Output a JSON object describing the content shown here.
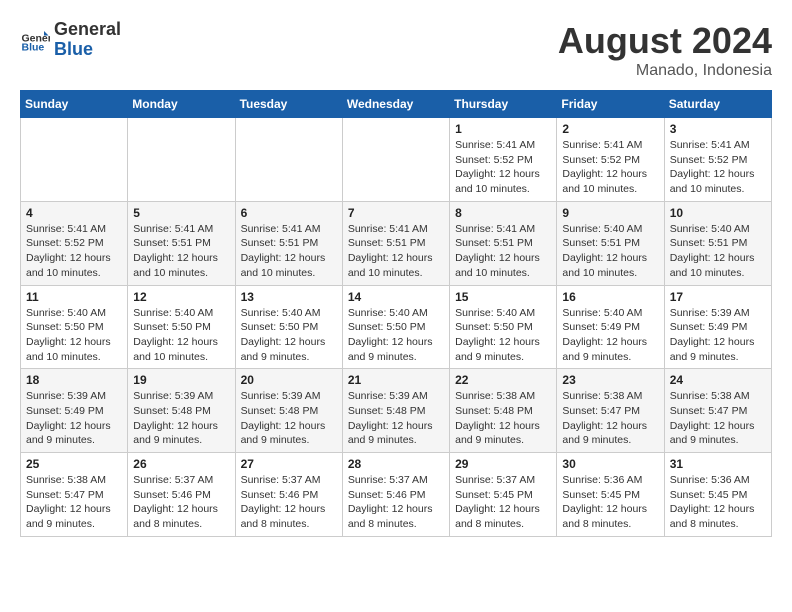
{
  "header": {
    "logo_text_general": "General",
    "logo_text_blue": "Blue",
    "month_year": "August 2024",
    "location": "Manado, Indonesia"
  },
  "days_of_week": [
    "Sunday",
    "Monday",
    "Tuesday",
    "Wednesday",
    "Thursday",
    "Friday",
    "Saturday"
  ],
  "weeks": [
    {
      "row_style": "white",
      "days": [
        {
          "num": "",
          "info": ""
        },
        {
          "num": "",
          "info": ""
        },
        {
          "num": "",
          "info": ""
        },
        {
          "num": "",
          "info": ""
        },
        {
          "num": "1",
          "info": "Sunrise: 5:41 AM\nSunset: 5:52 PM\nDaylight: 12 hours\nand 10 minutes."
        },
        {
          "num": "2",
          "info": "Sunrise: 5:41 AM\nSunset: 5:52 PM\nDaylight: 12 hours\nand 10 minutes."
        },
        {
          "num": "3",
          "info": "Sunrise: 5:41 AM\nSunset: 5:52 PM\nDaylight: 12 hours\nand 10 minutes."
        }
      ]
    },
    {
      "row_style": "gray",
      "days": [
        {
          "num": "4",
          "info": "Sunrise: 5:41 AM\nSunset: 5:52 PM\nDaylight: 12 hours\nand 10 minutes."
        },
        {
          "num": "5",
          "info": "Sunrise: 5:41 AM\nSunset: 5:51 PM\nDaylight: 12 hours\nand 10 minutes."
        },
        {
          "num": "6",
          "info": "Sunrise: 5:41 AM\nSunset: 5:51 PM\nDaylight: 12 hours\nand 10 minutes."
        },
        {
          "num": "7",
          "info": "Sunrise: 5:41 AM\nSunset: 5:51 PM\nDaylight: 12 hours\nand 10 minutes."
        },
        {
          "num": "8",
          "info": "Sunrise: 5:41 AM\nSunset: 5:51 PM\nDaylight: 12 hours\nand 10 minutes."
        },
        {
          "num": "9",
          "info": "Sunrise: 5:40 AM\nSunset: 5:51 PM\nDaylight: 12 hours\nand 10 minutes."
        },
        {
          "num": "10",
          "info": "Sunrise: 5:40 AM\nSunset: 5:51 PM\nDaylight: 12 hours\nand 10 minutes."
        }
      ]
    },
    {
      "row_style": "white",
      "days": [
        {
          "num": "11",
          "info": "Sunrise: 5:40 AM\nSunset: 5:50 PM\nDaylight: 12 hours\nand 10 minutes."
        },
        {
          "num": "12",
          "info": "Sunrise: 5:40 AM\nSunset: 5:50 PM\nDaylight: 12 hours\nand 10 minutes."
        },
        {
          "num": "13",
          "info": "Sunrise: 5:40 AM\nSunset: 5:50 PM\nDaylight: 12 hours\nand 9 minutes."
        },
        {
          "num": "14",
          "info": "Sunrise: 5:40 AM\nSunset: 5:50 PM\nDaylight: 12 hours\nand 9 minutes."
        },
        {
          "num": "15",
          "info": "Sunrise: 5:40 AM\nSunset: 5:50 PM\nDaylight: 12 hours\nand 9 minutes."
        },
        {
          "num": "16",
          "info": "Sunrise: 5:40 AM\nSunset: 5:49 PM\nDaylight: 12 hours\nand 9 minutes."
        },
        {
          "num": "17",
          "info": "Sunrise: 5:39 AM\nSunset: 5:49 PM\nDaylight: 12 hours\nand 9 minutes."
        }
      ]
    },
    {
      "row_style": "gray",
      "days": [
        {
          "num": "18",
          "info": "Sunrise: 5:39 AM\nSunset: 5:49 PM\nDaylight: 12 hours\nand 9 minutes."
        },
        {
          "num": "19",
          "info": "Sunrise: 5:39 AM\nSunset: 5:48 PM\nDaylight: 12 hours\nand 9 minutes."
        },
        {
          "num": "20",
          "info": "Sunrise: 5:39 AM\nSunset: 5:48 PM\nDaylight: 12 hours\nand 9 minutes."
        },
        {
          "num": "21",
          "info": "Sunrise: 5:39 AM\nSunset: 5:48 PM\nDaylight: 12 hours\nand 9 minutes."
        },
        {
          "num": "22",
          "info": "Sunrise: 5:38 AM\nSunset: 5:48 PM\nDaylight: 12 hours\nand 9 minutes."
        },
        {
          "num": "23",
          "info": "Sunrise: 5:38 AM\nSunset: 5:47 PM\nDaylight: 12 hours\nand 9 minutes."
        },
        {
          "num": "24",
          "info": "Sunrise: 5:38 AM\nSunset: 5:47 PM\nDaylight: 12 hours\nand 9 minutes."
        }
      ]
    },
    {
      "row_style": "white",
      "days": [
        {
          "num": "25",
          "info": "Sunrise: 5:38 AM\nSunset: 5:47 PM\nDaylight: 12 hours\nand 9 minutes."
        },
        {
          "num": "26",
          "info": "Sunrise: 5:37 AM\nSunset: 5:46 PM\nDaylight: 12 hours\nand 8 minutes."
        },
        {
          "num": "27",
          "info": "Sunrise: 5:37 AM\nSunset: 5:46 PM\nDaylight: 12 hours\nand 8 minutes."
        },
        {
          "num": "28",
          "info": "Sunrise: 5:37 AM\nSunset: 5:46 PM\nDaylight: 12 hours\nand 8 minutes."
        },
        {
          "num": "29",
          "info": "Sunrise: 5:37 AM\nSunset: 5:45 PM\nDaylight: 12 hours\nand 8 minutes."
        },
        {
          "num": "30",
          "info": "Sunrise: 5:36 AM\nSunset: 5:45 PM\nDaylight: 12 hours\nand 8 minutes."
        },
        {
          "num": "31",
          "info": "Sunrise: 5:36 AM\nSunset: 5:45 PM\nDaylight: 12 hours\nand 8 minutes."
        }
      ]
    }
  ]
}
